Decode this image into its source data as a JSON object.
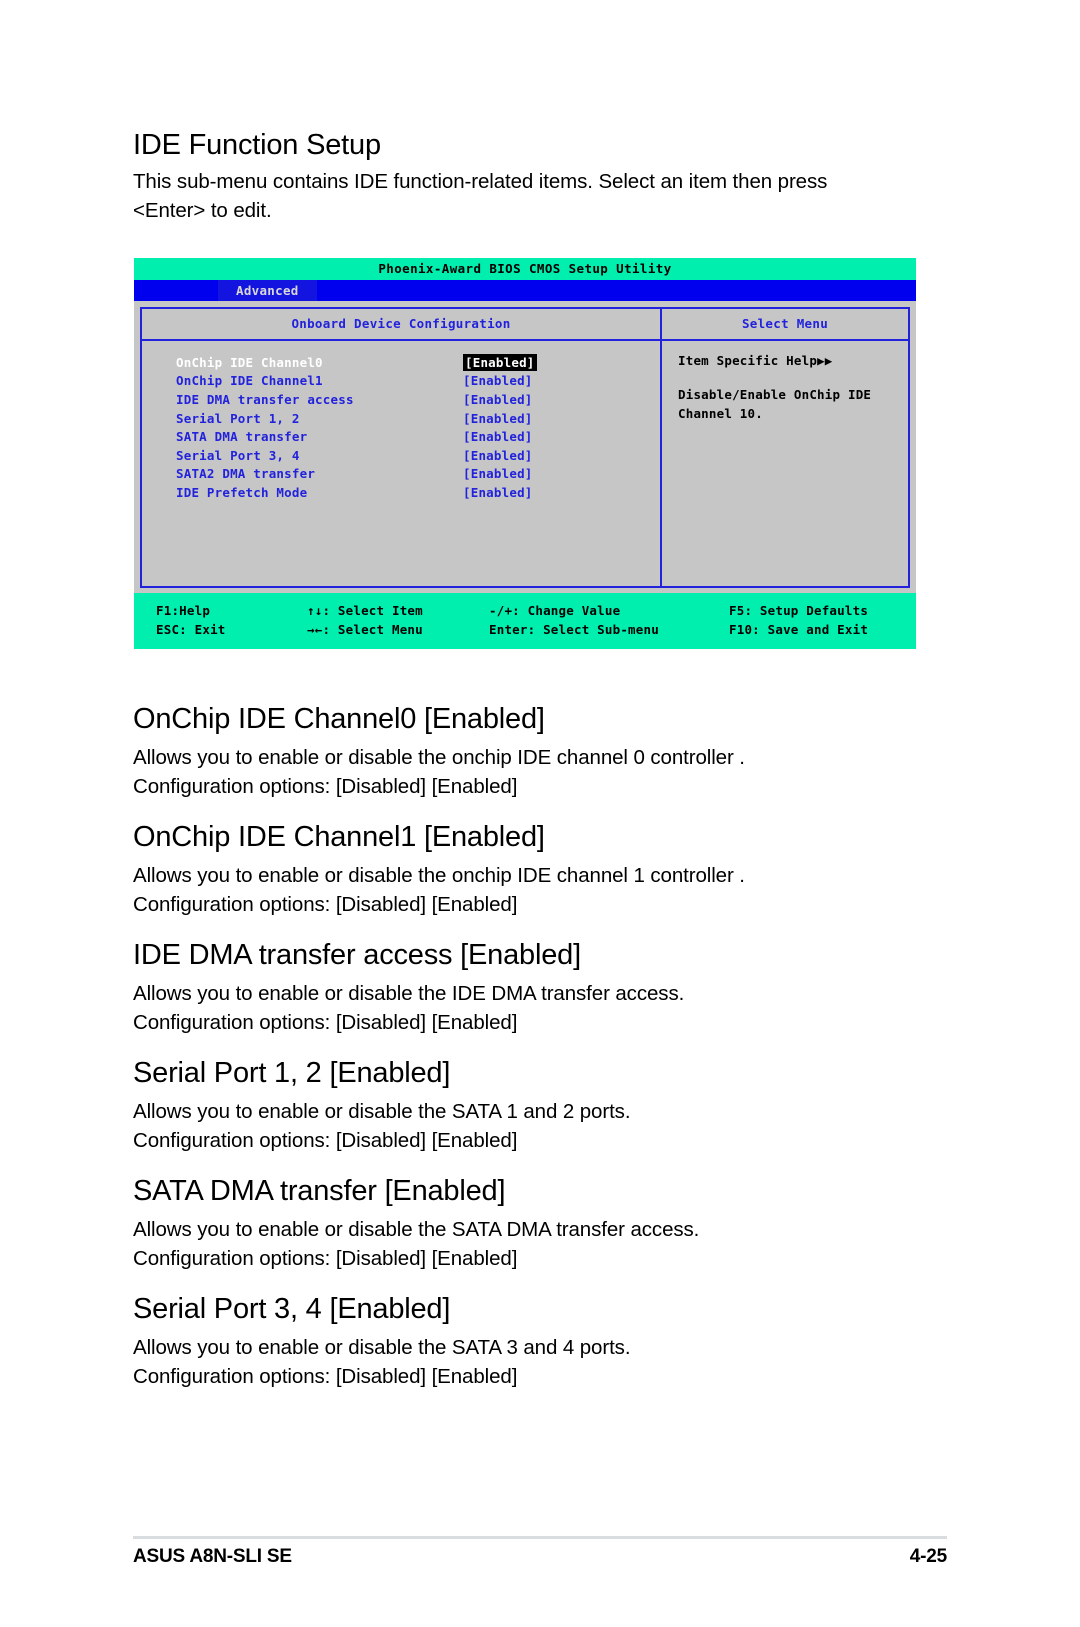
{
  "intro": {
    "title": "IDE Function Setup",
    "paragraph": "This sub-menu contains IDE function-related items. Select an item then press <Enter> to edit."
  },
  "bios": {
    "title": "Phoenix-Award BIOS CMOS Setup Utility",
    "tab": "Advanced",
    "left_pane_header": "Onboard Device Configuration",
    "right_pane_header": "Select Menu",
    "items": [
      {
        "label": "OnChip IDE Channel0",
        "value": "[Enabled]",
        "selected": true
      },
      {
        "label": "OnChip IDE Channel1",
        "value": "[Enabled]",
        "selected": false
      },
      {
        "label": "IDE DMA transfer access",
        "value": "[Enabled]",
        "selected": false
      },
      {
        "label": "Serial Port 1, 2",
        "value": "[Enabled]",
        "selected": false
      },
      {
        "label": "SATA DMA transfer",
        "value": "[Enabled]",
        "selected": false
      },
      {
        "label": "Serial Port 3, 4",
        "value": "[Enabled]",
        "selected": false
      },
      {
        "label": "SATA2 DMA transfer",
        "value": "[Enabled]",
        "selected": false
      },
      {
        "label": "IDE Prefetch Mode",
        "value": "[Enabled]",
        "selected": false
      }
    ],
    "help": {
      "heading": "Item Specific Help",
      "heading_arrows": "▶▶",
      "lines": [
        "Disable/Enable OnChip IDE",
        "Channel 10."
      ]
    },
    "footer": {
      "row1": [
        "F1:Help",
        "↑↓: Select Item",
        "-/+: Change Value",
        "F5: Setup Defaults"
      ],
      "row2": [
        "ESC: Exit",
        "→←: Select Menu",
        "Enter: Select Sub-menu",
        "F10: Save and Exit"
      ]
    },
    "colors": {
      "title_bar": "#00efaf",
      "tab_bar": "#0000ee",
      "panel": "#c6c6c6",
      "border": "#2222dd",
      "item_text": "#2222dd",
      "selected_text": "#ffffff",
      "selected_highlight": "#000000"
    }
  },
  "sections": [
    {
      "title": "OnChip IDE Channel0 [Enabled]",
      "lines": [
        "Allows you to enable or disable the onchip IDE channel 0 controller .",
        "Configuration options: [Disabled] [Enabled]"
      ]
    },
    {
      "title": "OnChip IDE Channel1 [Enabled]",
      "lines": [
        "Allows you to enable or disable the onchip IDE channel 1 controller .",
        "Configuration options: [Disabled] [Enabled]"
      ]
    },
    {
      "title": "IDE DMA transfer access [Enabled]",
      "lines": [
        "Allows you to enable or disable the IDE DMA transfer access.",
        "Configuration options: [Disabled] [Enabled]"
      ]
    },
    {
      "title": "Serial Port 1, 2 [Enabled]",
      "lines": [
        "Allows you to enable or disable the SATA 1 and 2 ports.",
        "Configuration options: [Disabled] [Enabled]"
      ]
    },
    {
      "title": "SATA DMA transfer [Enabled]",
      "lines": [
        "Allows you to enable or disable the SATA DMA transfer access.",
        "Configuration options: [Disabled] [Enabled]"
      ]
    },
    {
      "title": "Serial Port 3, 4 [Enabled]",
      "lines": [
        "Allows you to enable or disable the SATA 3 and 4 ports.",
        "Configuration options: [Disabled] [Enabled]"
      ]
    }
  ],
  "footer": {
    "product": "ASUS A8N-SLI SE",
    "page": "4-25"
  }
}
